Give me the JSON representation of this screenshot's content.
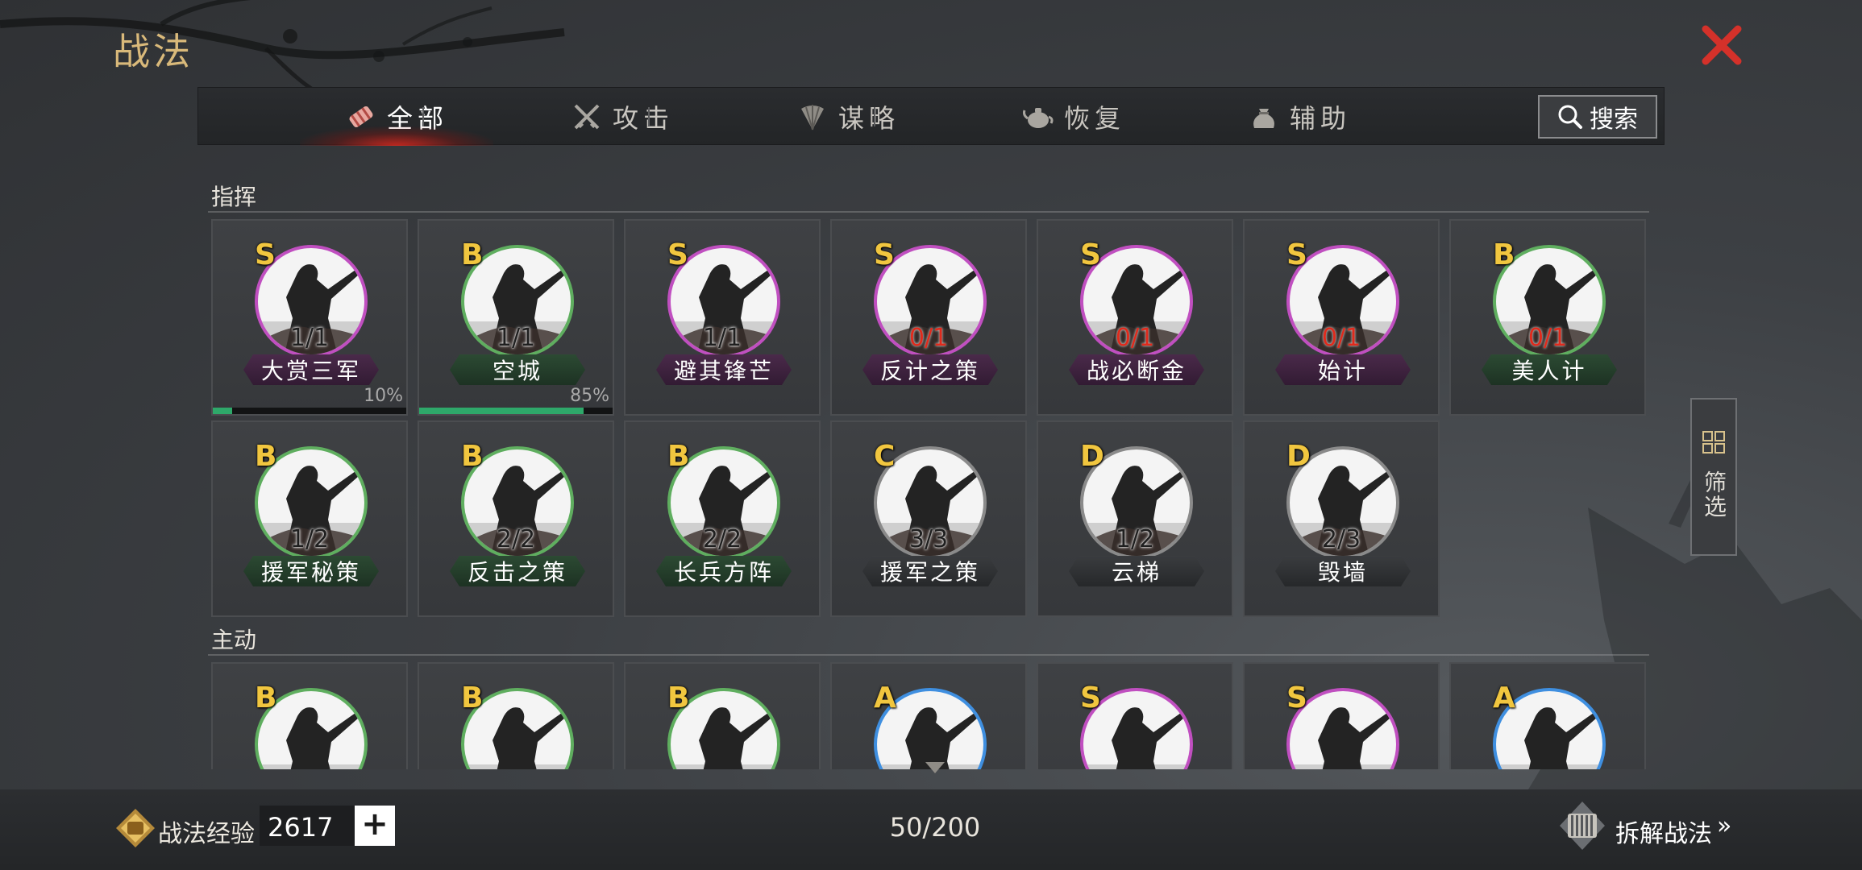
{
  "header": {
    "title": "战法",
    "close_icon": "close-x-icon"
  },
  "tabs": [
    {
      "label": "全部",
      "icon": "scroll-bundle-icon",
      "active": true
    },
    {
      "label": "攻击",
      "icon": "crossed-swords-icon",
      "active": false
    },
    {
      "label": "谋略",
      "icon": "feather-fan-icon",
      "active": false
    },
    {
      "label": "恢复",
      "icon": "teapot-icon",
      "active": false
    },
    {
      "label": "辅助",
      "icon": "pouch-icon",
      "active": false
    }
  ],
  "search": {
    "label": "搜索",
    "icon": "search-icon"
  },
  "sections": [
    {
      "title": "指挥",
      "cards": [
        {
          "grade": "S",
          "level": "1/1",
          "name": "大赏三军",
          "color": "purple",
          "progress": 0.1,
          "progress_label": "10%"
        },
        {
          "grade": "B",
          "level": "1/1",
          "name": "空城",
          "color": "green",
          "progress": 0.85,
          "progress_label": "85%"
        },
        {
          "grade": "S",
          "level": "1/1",
          "name": "避其锋芒",
          "color": "purple"
        },
        {
          "grade": "S",
          "level": "0/1",
          "name": "反计之策",
          "color": "purple"
        },
        {
          "grade": "S",
          "level": "0/1",
          "name": "战必断金",
          "color": "purple"
        },
        {
          "grade": "S",
          "level": "0/1",
          "name": "始计",
          "color": "purple"
        },
        {
          "grade": "B",
          "level": "0/1",
          "name": "美人计",
          "color": "green"
        },
        {
          "grade": "B",
          "level": "1/2",
          "name": "援军秘策",
          "color": "green"
        },
        {
          "grade": "B",
          "level": "2/2",
          "name": "反击之策",
          "color": "green"
        },
        {
          "grade": "B",
          "level": "2/2",
          "name": "长兵方阵",
          "color": "green"
        },
        {
          "grade": "C",
          "level": "3/3",
          "name": "援军之策",
          "color": "gray"
        },
        {
          "grade": "D",
          "level": "1/2",
          "name": "云梯",
          "color": "gray"
        },
        {
          "grade": "D",
          "level": "2/3",
          "name": "毁墙",
          "color": "gray"
        }
      ]
    },
    {
      "title": "主动",
      "cards": [
        {
          "grade": "B",
          "color": "green"
        },
        {
          "grade": "B",
          "color": "green"
        },
        {
          "grade": "B",
          "color": "green"
        },
        {
          "grade": "A",
          "color": "blue"
        },
        {
          "grade": "S",
          "color": "purple"
        },
        {
          "grade": "S",
          "color": "purple"
        },
        {
          "grade": "A",
          "color": "blue"
        }
      ]
    }
  ],
  "filter": {
    "label": "筛选",
    "icon": "grid-filter-icon"
  },
  "footer": {
    "exp_label": "战法经验",
    "exp_value": "2617",
    "exp_icon": "exp-scroll-icon",
    "plus_label": "+",
    "count": "50/200",
    "dismantle_label": "拆解战法",
    "dismantle_icon": "bamboo-scroll-icon",
    "dismantle_arrow": "»"
  },
  "colors": {
    "purple": "#c04fc0",
    "green": "#5fae5f",
    "blue": "#3f8fe0",
    "gray": "#8a8a8a",
    "grade": "#f1c63f",
    "title": "#d9b97a",
    "close": "#d4312a"
  }
}
